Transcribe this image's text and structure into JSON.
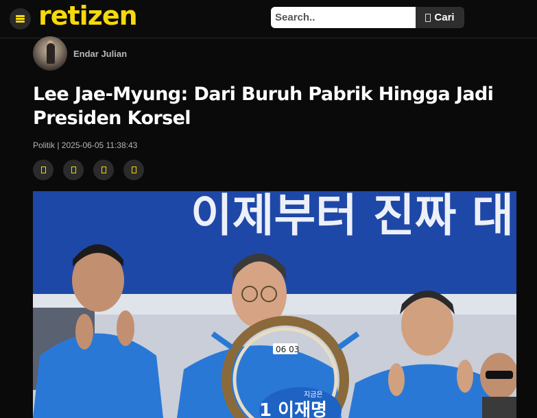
{
  "header": {
    "logo_text": "retizen",
    "menu_icon": "hamburger-menu-icon",
    "search_placeholder": "Search..",
    "search_button_label": "Cari",
    "search_button_icon": "search-icon"
  },
  "article": {
    "author_name": "Endar Julian",
    "title": "Lee Jae-Myung: Dari Buruh Pabrik Hingga Jadi Presiden Korsel",
    "meta": "Politik | 2025-06-05 11:38:43",
    "share_icons": [
      "facebook-icon",
      "twitter-icon",
      "whatsapp-icon",
      "link-icon"
    ],
    "hero_banner_text": "이제부터 진짜 대",
    "hero_wheel_date": "06 03",
    "hero_sign_small": "지금은",
    "hero_sign_large": "1 이재명"
  },
  "colors": {
    "background": "#0a0a0a",
    "brand_yellow": "#f5d90a",
    "button_dark": "#2e2e2e",
    "campaign_blue": "#1f47a8"
  }
}
